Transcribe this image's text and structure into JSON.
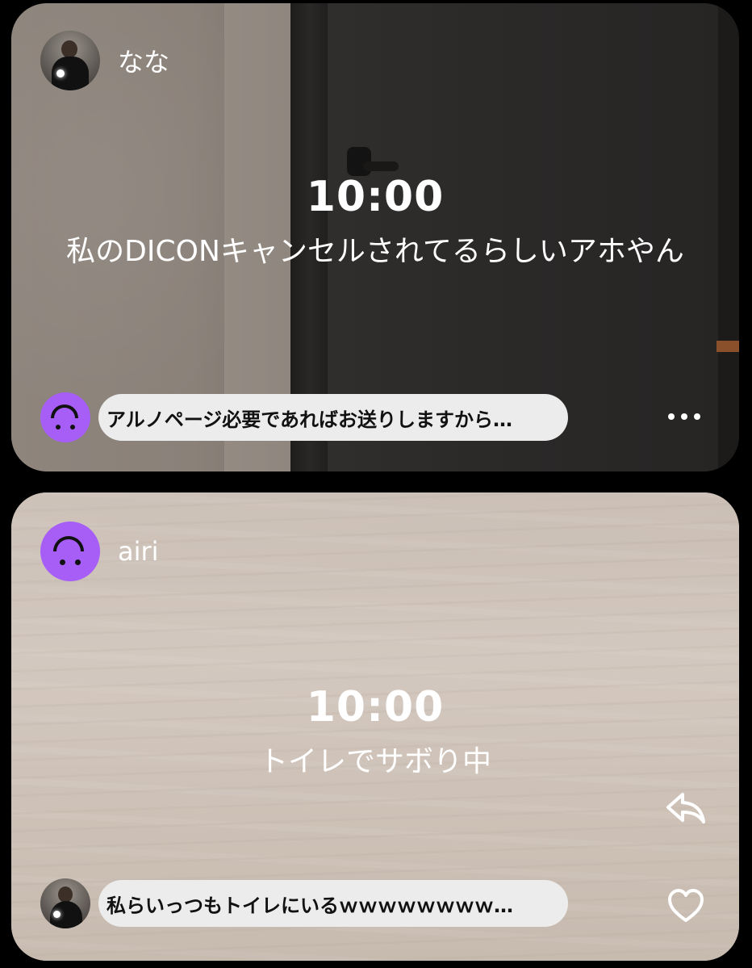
{
  "posts": [
    {
      "username": "なな",
      "avatar": "person-photo",
      "time": "10:00",
      "caption": "私のDICONキャンセルされてるらしいアホやん",
      "comment": {
        "avatar": "purple-smile-face",
        "text": "アルノページ必要であればお送りしますから…"
      },
      "action_icon": "more-dots-icon"
    },
    {
      "username": "airi",
      "avatar": "purple-smile-face",
      "time": "10:00",
      "caption": "トイレでサボり中",
      "comment": {
        "avatar": "person-photo",
        "text": "私らいっつもトイレにいるｗｗｗｗｗｗｗｗ…"
      },
      "action_icons": [
        "reply-icon",
        "heart-icon"
      ]
    }
  ],
  "colors": {
    "avatar_purple": "#a65ef7",
    "bubble_bg": "#ececec",
    "text_white": "#ffffff"
  }
}
